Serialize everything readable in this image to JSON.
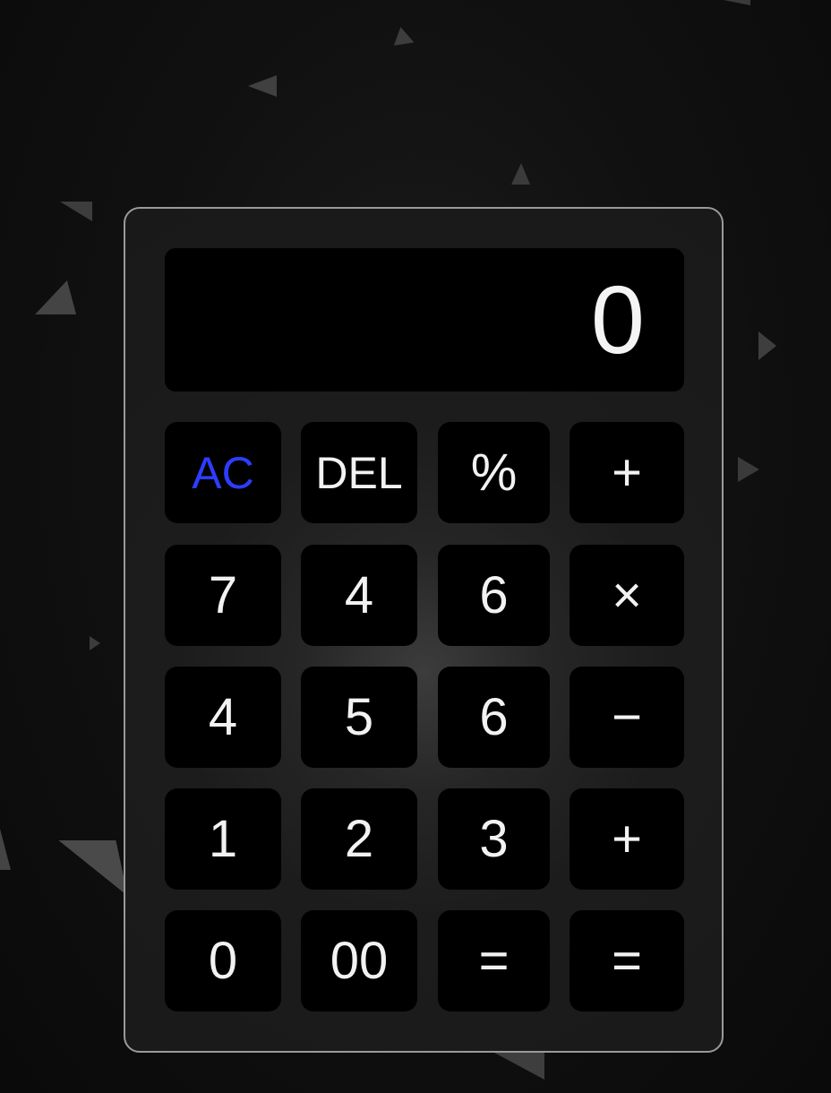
{
  "display": {
    "value": "0"
  },
  "keys": {
    "row1": [
      "AC",
      "DEL",
      "%",
      "+"
    ],
    "row2": [
      "7",
      "4",
      "6",
      "×"
    ],
    "row3": [
      "4",
      "5",
      "6",
      "−"
    ],
    "row4": [
      "1",
      "2",
      "3",
      "+"
    ],
    "row5": [
      "0",
      "00",
      "=",
      "="
    ]
  },
  "colors": {
    "accent": "#2c3dff",
    "key_background": "#000000",
    "key_text": "#f2f2f2",
    "panel_border": "#9a9a9a"
  }
}
